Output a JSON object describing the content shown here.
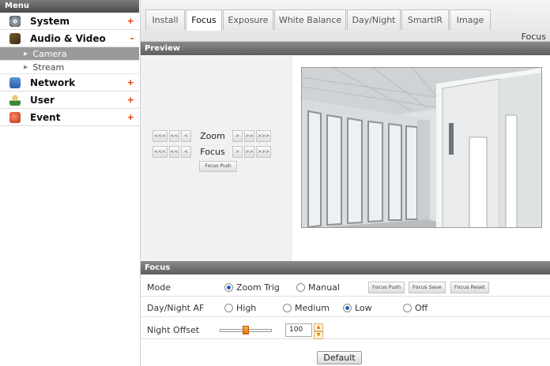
{
  "sidebar": {
    "header": "Menu",
    "items": [
      {
        "label": "System",
        "sign": "+",
        "icon": "gear-icon"
      },
      {
        "label": "Audio & Video",
        "sign": "–",
        "icon": "camera-icon"
      },
      {
        "label": "Network",
        "sign": "+",
        "icon": "network-icon"
      },
      {
        "label": "User",
        "sign": "+",
        "icon": "user-icon"
      },
      {
        "label": "Event",
        "sign": "+",
        "icon": "event-icon"
      }
    ],
    "sub_items": [
      {
        "label": "Camera",
        "active": true
      },
      {
        "label": "Stream",
        "active": false
      }
    ]
  },
  "tabs": [
    {
      "label": "Install"
    },
    {
      "label": "Focus",
      "active": true
    },
    {
      "label": "Exposure"
    },
    {
      "label": "White Balance"
    },
    {
      "label": "Day/Night"
    },
    {
      "label": "SmartIR"
    },
    {
      "label": "Image"
    }
  ],
  "page_title": "Focus",
  "preview": {
    "title": "Preview",
    "zoom_label": "Zoom",
    "focus_label": "Focus",
    "btn_fast_left": "<<<",
    "btn_mid_left": "<<",
    "btn_slow_left": "<",
    "btn_slow_right": ">",
    "btn_mid_right": ">>",
    "btn_fast_right": ">>>",
    "focus_push": "Focus Push"
  },
  "focus": {
    "title": "Focus",
    "mode_label": "Mode",
    "mode_options": [
      "Zoom Trig",
      "Manual"
    ],
    "mode_selected": "Zoom Trig",
    "focus_push": "Focus Push",
    "focus_save": "Focus Save",
    "focus_reset": "Focus Reset",
    "daynight_label": "Day/Night AF",
    "daynight_options": [
      "High",
      "Medium",
      "Low",
      "Off"
    ],
    "daynight_selected": "Low",
    "night_offset_label": "Night Offset",
    "night_offset_value": "100",
    "night_offset_fraction": 0.5,
    "default_button": "Default"
  },
  "colors": {
    "accent": "#1f5fbf",
    "plus_sign": "#e03a00",
    "section_bar": "#6e6e6e"
  }
}
